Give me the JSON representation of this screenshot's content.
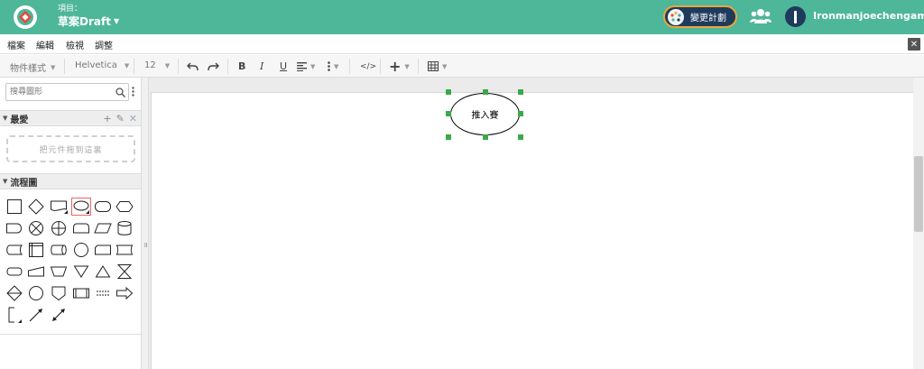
{
  "header": {
    "project_label": "項目：",
    "project_name": "草案Draft",
    "change_plan_label": "變更計劃",
    "username": "Ironmanjoechengame"
  },
  "menu": {
    "items": [
      "檔案",
      "編輯",
      "檢視",
      "調整"
    ],
    "close_symbol": "✕"
  },
  "toolbar": {
    "style_label": "物件樣式",
    "font_family": "Helvetica",
    "font_size": "12",
    "bold": "B",
    "italic": "I",
    "underline": "U",
    "code_label": "</>",
    "insert_label": "+"
  },
  "sidebar": {
    "search_placeholder": "搜尋圖形",
    "favorites_title": "最愛",
    "favorites_actions": [
      "+",
      "✎",
      "✕"
    ],
    "drop_zone_text": "把元件拖到這裏",
    "flowchart_title": "流程圖"
  },
  "canvas": {
    "selected_shape_text": "推入賽"
  },
  "colors": {
    "header_bg": "#4eb699",
    "plan_button_bg": "#1f3b5c",
    "plan_button_border": "#e8a53d",
    "handle": "#3aa94a",
    "selected_shape_border": "#e56666"
  }
}
